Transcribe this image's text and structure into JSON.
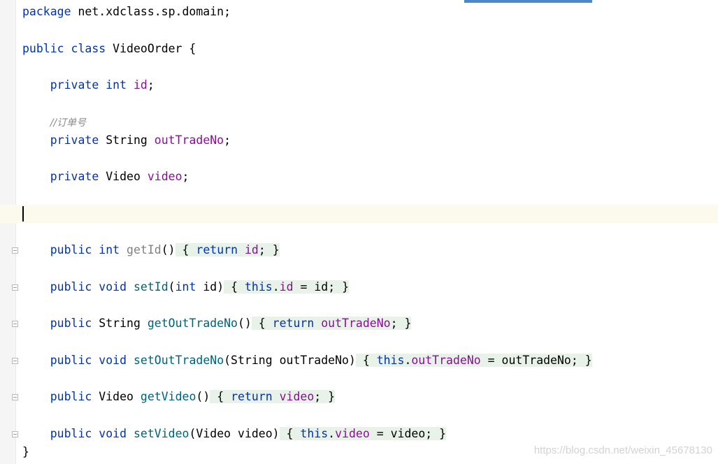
{
  "editor": {
    "lines": {
      "package_kw": "package",
      "package_name": " net.xdclass.sp.domain;",
      "class_public": "public",
      "class_kw": "class",
      "class_name": " VideoOrder {",
      "id_private": "private",
      "id_type": "int",
      "id_name": "id",
      "comment": "//订单号",
      "out_private": "private",
      "out_type": " String ",
      "out_name": "outTradeNo",
      "video_private": "private",
      "video_type": " Video ",
      "video_name": "video",
      "closing_brace": "}"
    },
    "methods": {
      "get_id": {
        "public": "public",
        "type": "int",
        "name": "getId",
        "params": "()",
        "open": "{",
        "ret": "return",
        "field": "id",
        "tail": ";",
        "close": "}"
      },
      "set_id": {
        "public": "public",
        "type": "void",
        "name": "setId",
        "p_open": "(",
        "p_type": "int",
        "p_name": " id)",
        "open": "{",
        "this_kw": "this",
        "dot": ".",
        "field": "id",
        "assign": " = id;",
        "close": "}"
      },
      "get_out": {
        "public": "public",
        "type": " String ",
        "name": "getOutTradeNo",
        "params": "()",
        "open": "{",
        "ret": "return",
        "field": "outTradeNo",
        "tail": ";",
        "close": "}"
      },
      "set_out": {
        "public": "public",
        "type": "void",
        "name": "setOutTradeNo",
        "params": "(String outTradeNo)",
        "open": "{",
        "this_kw": "this",
        "dot": ".",
        "field": "outTradeNo",
        "assign": " = outTradeNo;",
        "close": "}"
      },
      "get_video": {
        "public": "public",
        "type": " Video ",
        "name": "getVideo",
        "params": "()",
        "open": "{",
        "ret": "return",
        "field": "video",
        "tail": ";",
        "close": "}"
      },
      "set_video": {
        "public": "public",
        "type": "void",
        "name": "setVideo",
        "params": "(Video video)",
        "open": "{",
        "this_kw": "this",
        "dot": ".",
        "field": "video",
        "assign": " = video;",
        "close": "}"
      }
    }
  },
  "watermark": "https://blog.csdn.net/weixin_45678130",
  "colors": {
    "keyword": "#0033b3",
    "field": "#871094",
    "method": "#00627a",
    "comment": "#8c8c8c",
    "current_line": "#fcfaed",
    "folded_brace_bg": "#e8f2e8"
  }
}
